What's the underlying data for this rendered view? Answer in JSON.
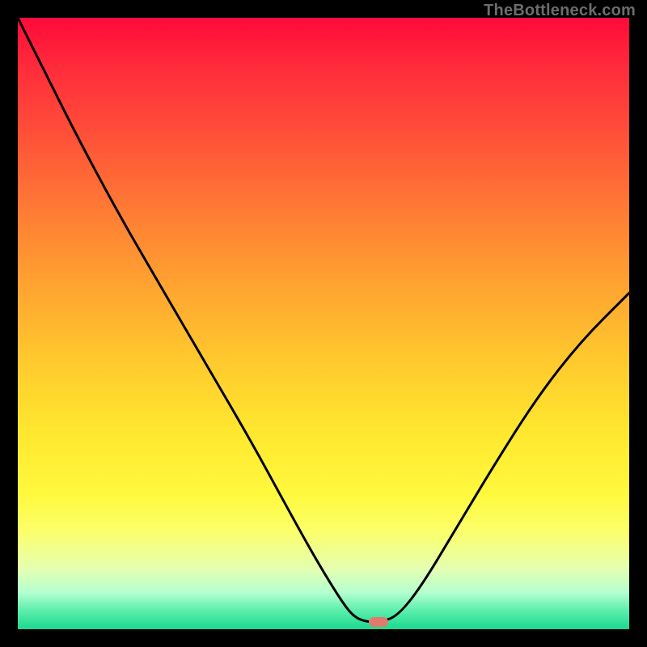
{
  "watermark": "TheBottleneck.com",
  "colors": {
    "frame": "#000000",
    "curve": "#000000",
    "marker": "#e17a6d",
    "watermark_text": "#6c6c6c",
    "gradient_top": "#ff0a3a",
    "gradient_bottom": "#1cd88e"
  },
  "chart_data": {
    "type": "line",
    "title": "",
    "xlabel": "",
    "ylabel": "",
    "xlim": [
      0,
      100
    ],
    "ylim": [
      0,
      100
    ],
    "grid": false,
    "legend": false,
    "curve_points": [
      {
        "x": 0,
        "y": 100
      },
      {
        "x": 4,
        "y": 92
      },
      {
        "x": 10,
        "y": 80
      },
      {
        "x": 17,
        "y": 67
      },
      {
        "x": 24,
        "y": 55
      },
      {
        "x": 31,
        "y": 43
      },
      {
        "x": 38,
        "y": 31
      },
      {
        "x": 44,
        "y": 20
      },
      {
        "x": 49,
        "y": 11
      },
      {
        "x": 53,
        "y": 4.5
      },
      {
        "x": 55,
        "y": 2
      },
      {
        "x": 57,
        "y": 1.2
      },
      {
        "x": 59,
        "y": 1.2
      },
      {
        "x": 62,
        "y": 2
      },
      {
        "x": 66,
        "y": 7
      },
      {
        "x": 72,
        "y": 17
      },
      {
        "x": 78,
        "y": 27
      },
      {
        "x": 85,
        "y": 38
      },
      {
        "x": 92,
        "y": 47
      },
      {
        "x": 100,
        "y": 55
      }
    ],
    "marker": {
      "x": 59,
      "y": 1.2,
      "shape": "pill"
    }
  }
}
